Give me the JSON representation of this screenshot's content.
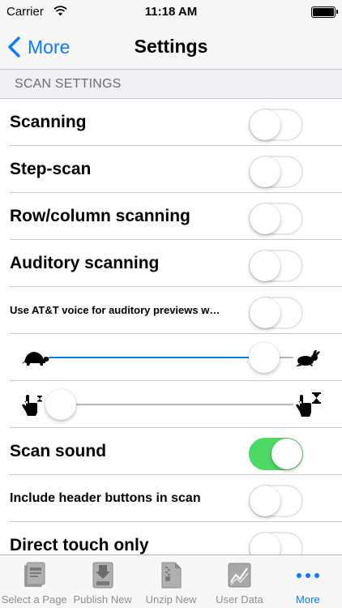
{
  "status_bar": {
    "carrier": "Carrier",
    "time": "11:18 AM"
  },
  "nav": {
    "back_label": "More",
    "title": "Settings"
  },
  "section": {
    "header": "SCAN SETTINGS"
  },
  "rows": [
    {
      "label": "Scanning",
      "on": false
    },
    {
      "label": "Step-scan",
      "on": false
    },
    {
      "label": "Row/column scanning",
      "on": false
    },
    {
      "label": "Auditory scanning",
      "on": false
    },
    {
      "label": "Use AT&T voice for auditory previews w…",
      "on": false
    },
    {
      "label": "Scan sound",
      "on": true
    },
    {
      "label": "Include header buttons in scan",
      "on": false
    },
    {
      "label": "Direct touch only",
      "on": false
    }
  ],
  "sliders": {
    "scan_speed": {
      "value": 0.88,
      "min_icon": "turtle-icon",
      "max_icon": "rabbit-icon"
    },
    "dwell_time": {
      "value": 0.0,
      "min_icon": "hand-short-timer-icon",
      "max_icon": "hand-long-timer-icon"
    }
  },
  "tab_bar": {
    "items": [
      {
        "label": "Select a Page",
        "icon": "select-page-icon",
        "active": false
      },
      {
        "label": "Publish New",
        "icon": "publish-icon",
        "active": false
      },
      {
        "label": "Unzip New",
        "icon": "unzip-icon",
        "active": false
      },
      {
        "label": "User Data",
        "icon": "user-data-icon",
        "active": false
      },
      {
        "label": "More",
        "icon": "more-icon",
        "active": true
      }
    ]
  },
  "colors": {
    "accent": "#0a7aff",
    "switch_on": "#4cd964",
    "separator": "#c8c7cc",
    "inactive_tab": "#8e8e93"
  }
}
